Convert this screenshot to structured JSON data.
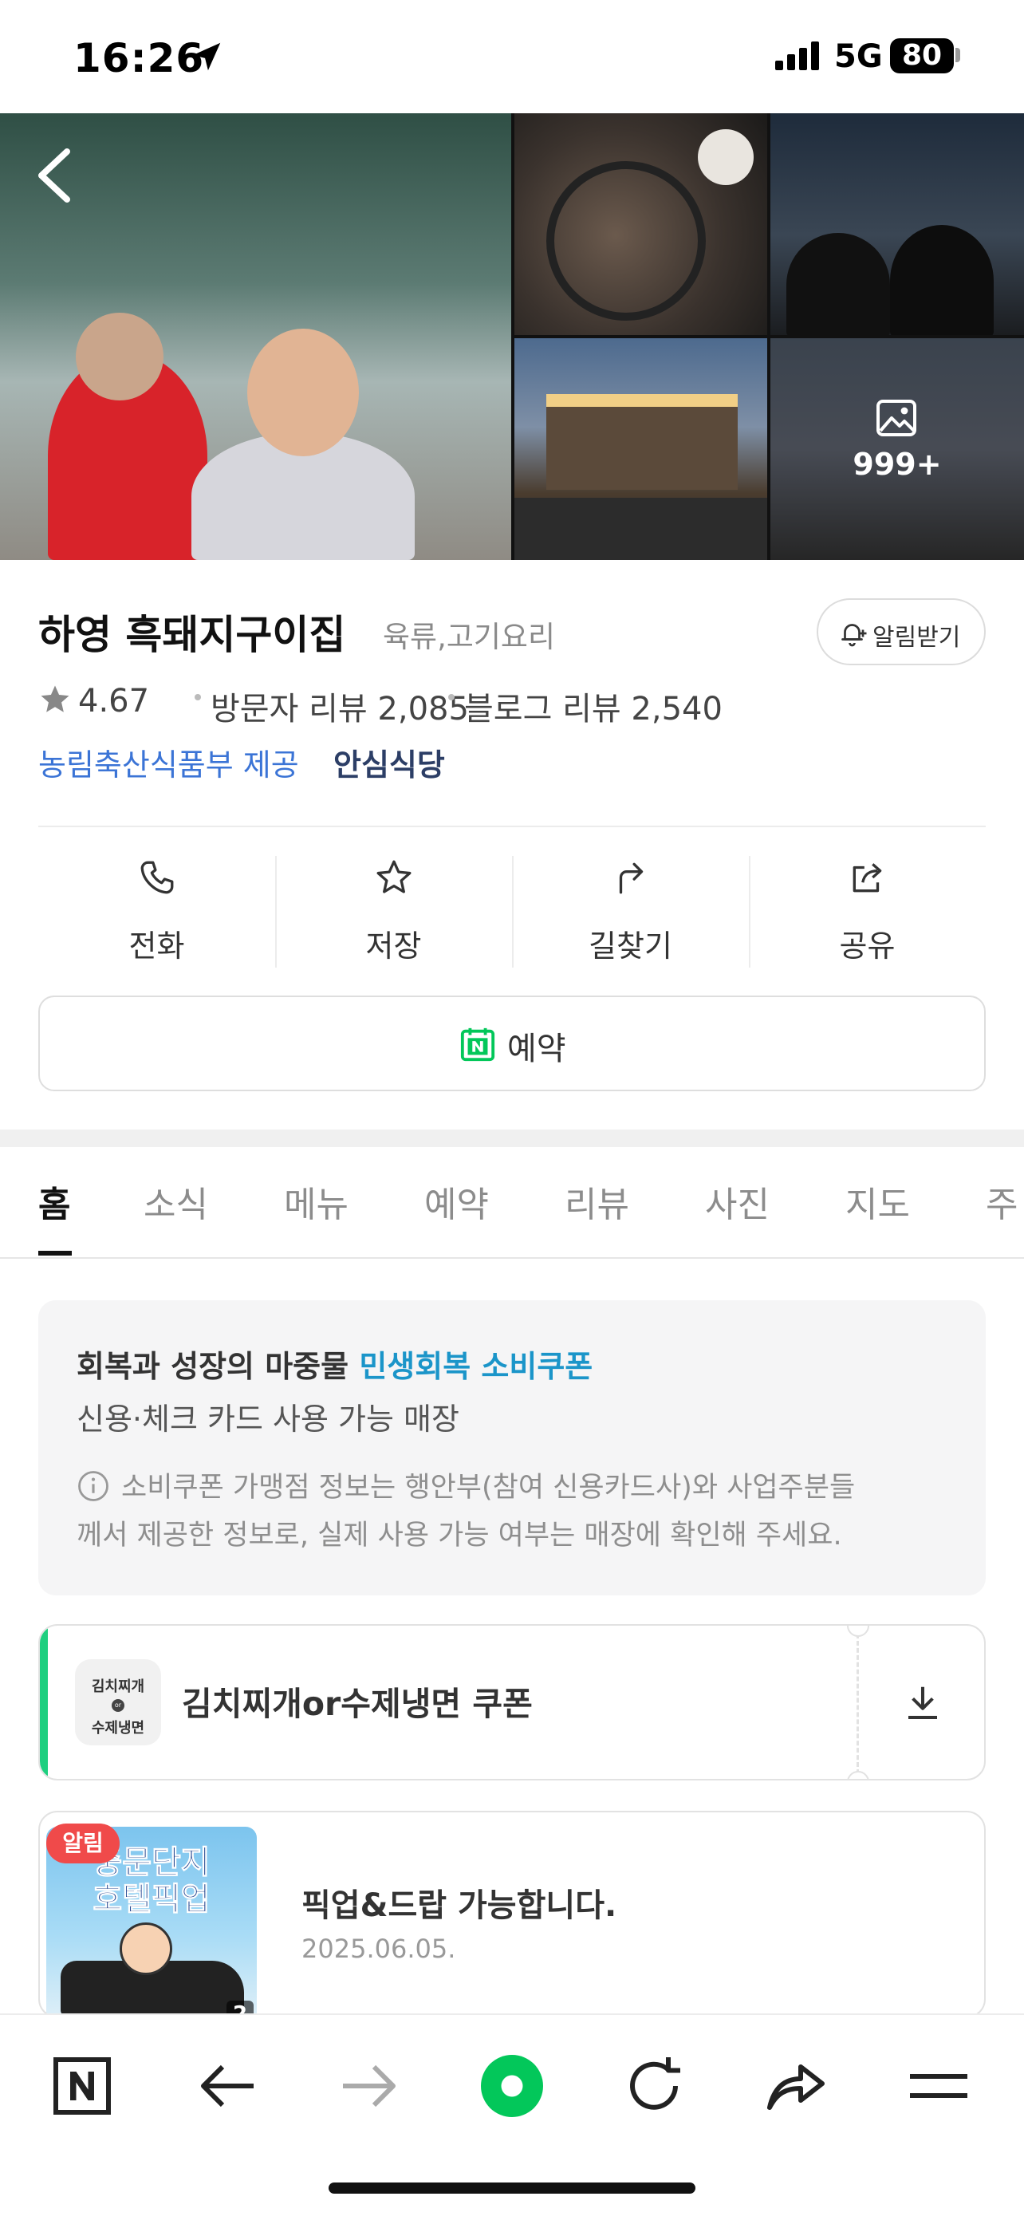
{
  "status_bar": {
    "time": "16:26",
    "network": "5G",
    "battery": "80"
  },
  "photos": {
    "more_count": "999+",
    "profile_badge": "my"
  },
  "place": {
    "name": "하영 흑돼지구이집",
    "category": "육류,고기요리",
    "alarm_label": "알림받기",
    "rating": "4.67",
    "visitor_reviews": "방문자 리뷰 2,085",
    "blog_reviews": "블로그 리뷰 2,540",
    "provider": "농림축산식품부 제공",
    "safe_label": "안심식당"
  },
  "actions": [
    {
      "label": "전화",
      "icon": "phone-icon"
    },
    {
      "label": "저장",
      "icon": "star-icon"
    },
    {
      "label": "길찾기",
      "icon": "directions-icon"
    },
    {
      "label": "공유",
      "icon": "share-icon"
    }
  ],
  "reserve": {
    "label": "예약"
  },
  "tabs": [
    "홈",
    "소식",
    "메뉴",
    "예약",
    "리뷰",
    "사진",
    "지도",
    "주"
  ],
  "voucher": {
    "title_prefix": "회복과 성장의 마중물",
    "title_highlight": "민생회복 소비쿠폰",
    "subtitle": "신용·체크 카드 사용 가능 매장",
    "note_line1": "소비쿠폰 가맹점 정보는 행안부(참여 신용카드사)와 사업주분들",
    "note_line2": "께서 제공한 정보로, 실제 사용 가능 여부는 매장에 확인해 주세요."
  },
  "coupon": {
    "thumb_top": "김치찌개",
    "thumb_mid": "or",
    "thumb_bottom": "수제냉면",
    "name": "김치찌개or수제냉면 쿠폰"
  },
  "news": {
    "badge": "알림",
    "thumb_line1": "중문단지",
    "thumb_line2": "호텔픽업",
    "thumb_count": "2",
    "title": "픽업&드랍 가능합니다.",
    "date": "2025.06.05."
  },
  "colors": {
    "naver_green": "#03c75a",
    "link_blue": "#3b74d6",
    "highlight_blue": "#1b95c9",
    "badge_red": "#f04a4a"
  }
}
